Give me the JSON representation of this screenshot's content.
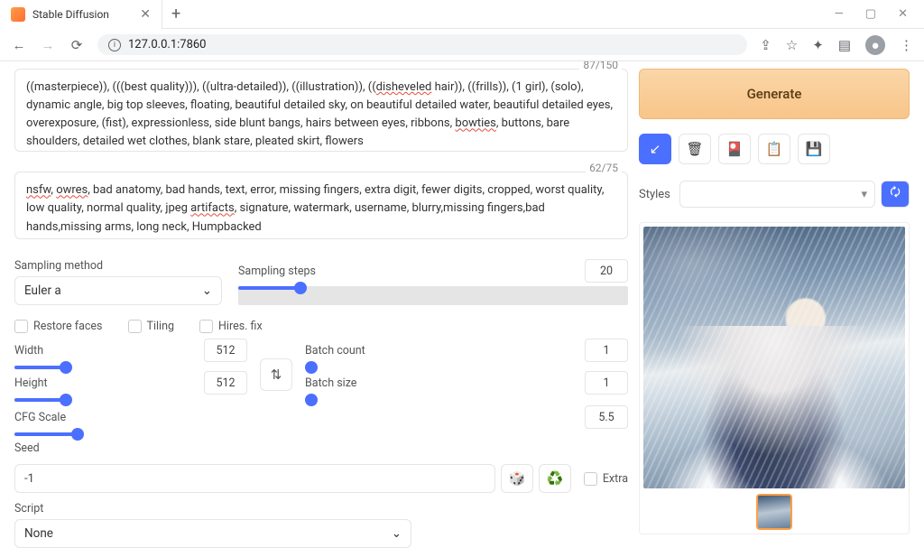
{
  "window": {
    "tab_title": "Stable Diffusion",
    "url": "127.0.0.1:7860"
  },
  "prompt": {
    "token_count": "87/150",
    "text_parts": [
      {
        "t": "((masterpiece)), (((best quality))), ((ultra-detailed)), ((illustration)), (("
      },
      {
        "t": "disheveled",
        "w": true
      },
      {
        "t": " hair)), ((frills)), (1 girl), (solo), dynamic angle, big top sleeves, floating, beautiful detailed sky, on beautiful detailed water,  beautiful detailed eyes, overexposure, (fist), expressionless, side blunt bangs, hairs between eyes, ribbons, "
      },
      {
        "t": "bowties",
        "w": true
      },
      {
        "t": ", buttons, bare shoulders,  detailed wet clothes, blank stare, pleated skirt, flowers"
      }
    ]
  },
  "negative_prompt": {
    "token_count": "62/75",
    "text_parts": [
      {
        "t": "nsfw",
        "w": true
      },
      {
        "t": ", "
      },
      {
        "t": "owres",
        "w": true
      },
      {
        "t": ", bad anatomy, bad hands, text, error, missing fingers, extra digit, fewer digits, cropped, worst quality, low quality, normal quality, jpeg "
      },
      {
        "t": "artifacts",
        "w": true
      },
      {
        "t": ", signature, watermark, username, blurry,missing fingers,bad hands,missing arms, long neck, Humpbacked"
      }
    ]
  },
  "controls": {
    "generate": "Generate",
    "styles_label": "Styles",
    "sampling_method_label": "Sampling method",
    "sampling_method_value": "Euler a",
    "sampling_steps_label": "Sampling steps",
    "sampling_steps_value": "20",
    "restore_faces": "Restore faces",
    "tiling": "Tiling",
    "hires_fix": "Hires. fix",
    "width_label": "Width",
    "width_value": "512",
    "height_label": "Height",
    "height_value": "512",
    "batch_count_label": "Batch count",
    "batch_count_value": "1",
    "batch_size_label": "Batch size",
    "batch_size_value": "1",
    "cfg_label": "CFG Scale",
    "cfg_value": "5.5",
    "seed_label": "Seed",
    "seed_value": "-1",
    "extra": "Extra",
    "script_label": "Script",
    "script_value": "None"
  }
}
